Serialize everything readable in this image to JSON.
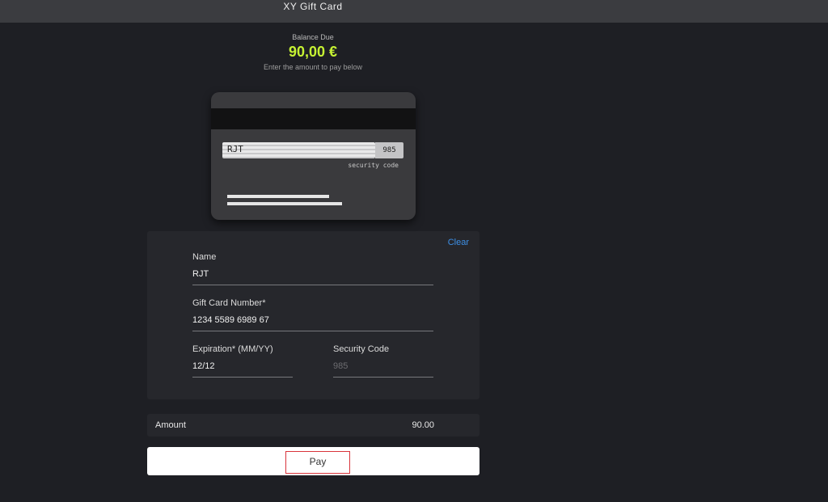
{
  "window": {
    "title": "XY Gift Card"
  },
  "balance": {
    "label": "Balance Due",
    "value": "90,00 €",
    "hint": "Enter the amount to pay below",
    "accent_color": "#c6f233"
  },
  "card_preview": {
    "name": "RJT",
    "security_code": "985",
    "security_caption": "security code"
  },
  "form": {
    "clear_label": "Clear",
    "name": {
      "label": "Name",
      "value": "RJT"
    },
    "card_number": {
      "label": "Gift Card Number*",
      "value": "1234 5589 6989 67"
    },
    "expiration": {
      "label": "Expiration* (MM/YY)",
      "value": "12/12"
    },
    "security_code": {
      "label": "Security Code",
      "placeholder": "985",
      "value": ""
    }
  },
  "amount": {
    "label": "Amount",
    "value": "90.00"
  },
  "pay": {
    "label": "Pay"
  }
}
